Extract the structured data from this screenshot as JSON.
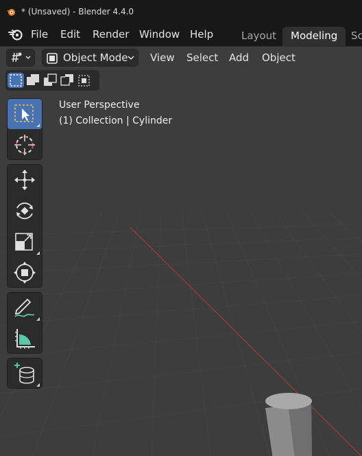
{
  "window": {
    "title": "* (Unsaved) - Blender 4.4.0"
  },
  "menubar": {
    "items": [
      "File",
      "Edit",
      "Render",
      "Window",
      "Help"
    ]
  },
  "workspace_tabs": [
    {
      "label": "Layout",
      "active": false
    },
    {
      "label": "Modeling",
      "active": true
    },
    {
      "label": "Sc",
      "active": false
    }
  ],
  "viewport_header": {
    "mode": "Object Mode",
    "menus": [
      "View",
      "Select",
      "Add",
      "Object"
    ]
  },
  "selection_modes": [
    "select-new",
    "select-extend",
    "select-subtract",
    "select-invert",
    "select-intersect"
  ],
  "toolbar": {
    "groups": [
      [
        "select-box-icon",
        "cursor-icon"
      ],
      [
        "move-icon",
        "rotate-icon",
        "scale-icon",
        "transform-icon"
      ],
      [
        "annotate-icon",
        "measure-icon"
      ],
      [
        "add-cylinder-icon"
      ]
    ],
    "active_tool": "select-box-icon"
  },
  "viewport": {
    "perspective_label": "User Perspective",
    "collection_label": "(1) Collection | Cylinder"
  },
  "colors": {
    "accent": "#4772b3",
    "background": "#3d3d3d",
    "x_axis": "#9a3a3a",
    "active_tab": "#303030"
  }
}
